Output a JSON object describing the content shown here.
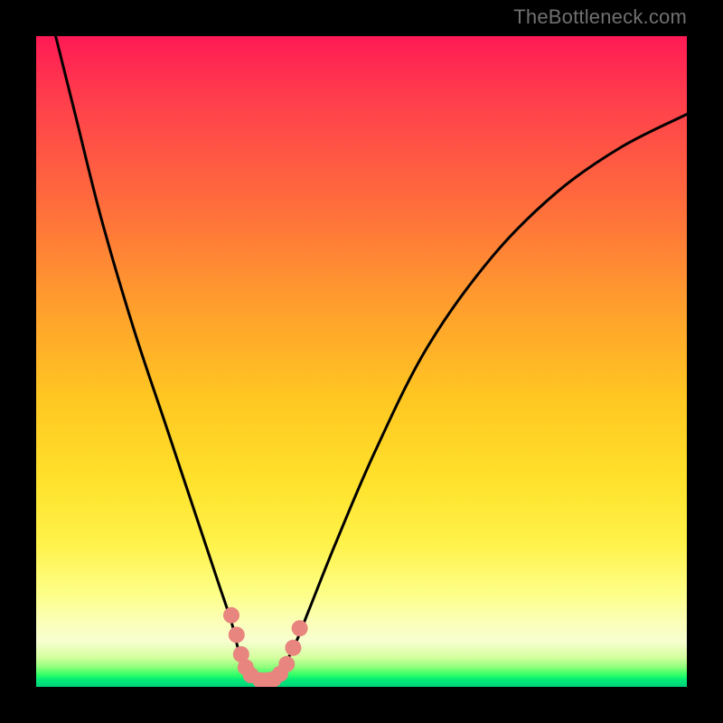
{
  "watermark": "TheBottleneck.com",
  "chart_data": {
    "type": "line",
    "title": "",
    "xlabel": "",
    "ylabel": "",
    "xlim": [
      0,
      100
    ],
    "ylim": [
      0,
      100
    ],
    "series": [
      {
        "name": "bottleneck-curve",
        "x": [
          3,
          6,
          10,
          15,
          20,
          25,
          28,
          30,
          31,
          32,
          33,
          34,
          35,
          36,
          37,
          38,
          40,
          42,
          46,
          52,
          60,
          70,
          80,
          90,
          100
        ],
        "y": [
          100,
          88,
          72,
          55,
          40,
          25,
          16,
          10,
          6,
          3,
          1.5,
          1,
          1,
          1,
          1.5,
          3,
          7,
          12,
          22,
          36,
          52,
          66,
          76,
          83,
          88
        ]
      }
    ],
    "marker_segments": [
      {
        "name": "left-trough-markers",
        "points": [
          {
            "x": 30.0,
            "y": 11.0
          },
          {
            "x": 30.8,
            "y": 8.0
          },
          {
            "x": 31.5,
            "y": 5.0
          },
          {
            "x": 32.2,
            "y": 3.0
          },
          {
            "x": 33.0,
            "y": 1.8
          }
        ]
      },
      {
        "name": "right-trough-markers",
        "points": [
          {
            "x": 34.5,
            "y": 1.0
          },
          {
            "x": 35.5,
            "y": 1.0
          },
          {
            "x": 36.5,
            "y": 1.2
          },
          {
            "x": 37.5,
            "y": 2.0
          },
          {
            "x": 38.5,
            "y": 3.5
          },
          {
            "x": 39.5,
            "y": 6.0
          },
          {
            "x": 40.5,
            "y": 9.0
          }
        ]
      }
    ],
    "notes": "No axis ticks or numeric labels are rendered; values are estimated on a 0–100 scale. The curve is a bottleneck V shape dipping to ~1% near x≈34 and rising to ~88% at the right edge. Salmon-colored dot markers accent the trough region."
  }
}
